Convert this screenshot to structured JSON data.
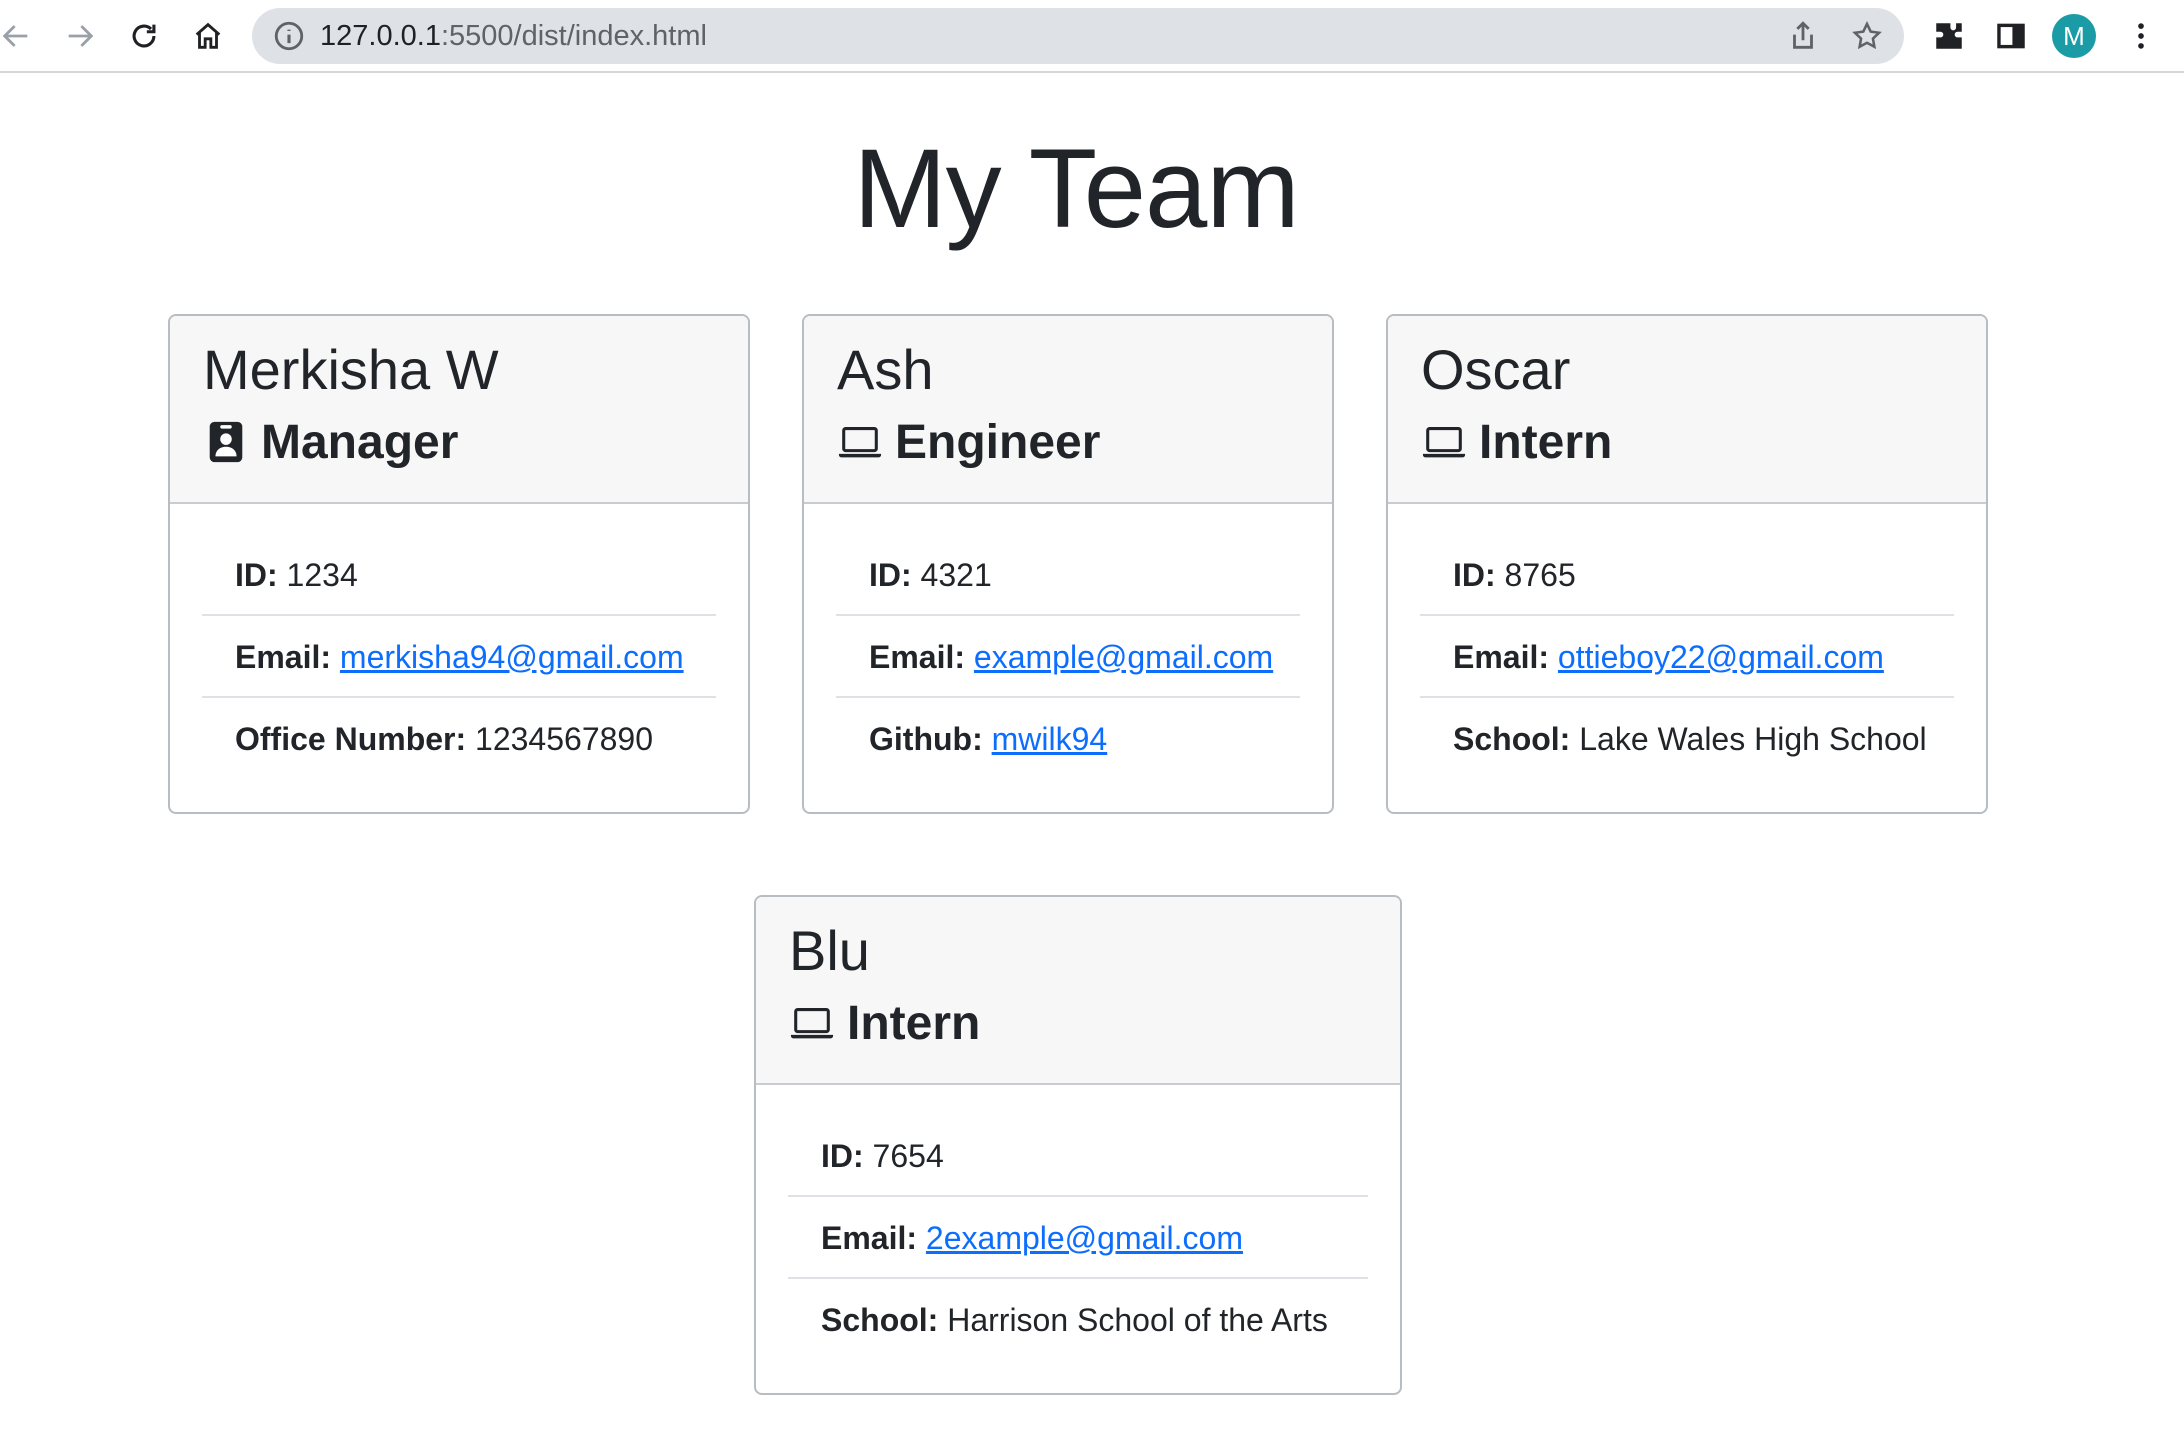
{
  "browser": {
    "url_host": "127.0.0.1",
    "url_path": ":5500/dist/index.html",
    "avatar_letter": "M"
  },
  "page": {
    "title": "My Team"
  },
  "cards": [
    {
      "name": "Merkisha W",
      "role": "Manager",
      "role_icon": "id-badge-icon",
      "id_label": "ID:",
      "id_value": "1234",
      "email_label": "Email:",
      "email_value": "merkisha94@gmail.com",
      "extra_label": "Office Number:",
      "extra_value": "1234567890"
    },
    {
      "name": "Ash",
      "role": "Engineer",
      "role_icon": "laptop-icon",
      "id_label": "ID:",
      "id_value": "4321",
      "email_label": "Email:",
      "email_value": "example@gmail.com",
      "extra_label": "Github:",
      "extra_value": "mwilk94"
    },
    {
      "name": "Oscar",
      "role": "Intern",
      "role_icon": "laptop-icon",
      "id_label": "ID:",
      "id_value": "8765",
      "email_label": "Email:",
      "email_value": "ottieboy22@gmail.com",
      "extra_label": "School:",
      "extra_value": "Lake Wales High School"
    },
    {
      "name": "Blu",
      "role": "Intern",
      "role_icon": "laptop-icon",
      "id_label": "ID:",
      "id_value": "7654",
      "email_label": "Email:",
      "email_value": "2example@gmail.com",
      "extra_label": "School:",
      "extra_value": "Harrison School of the Arts"
    }
  ]
}
